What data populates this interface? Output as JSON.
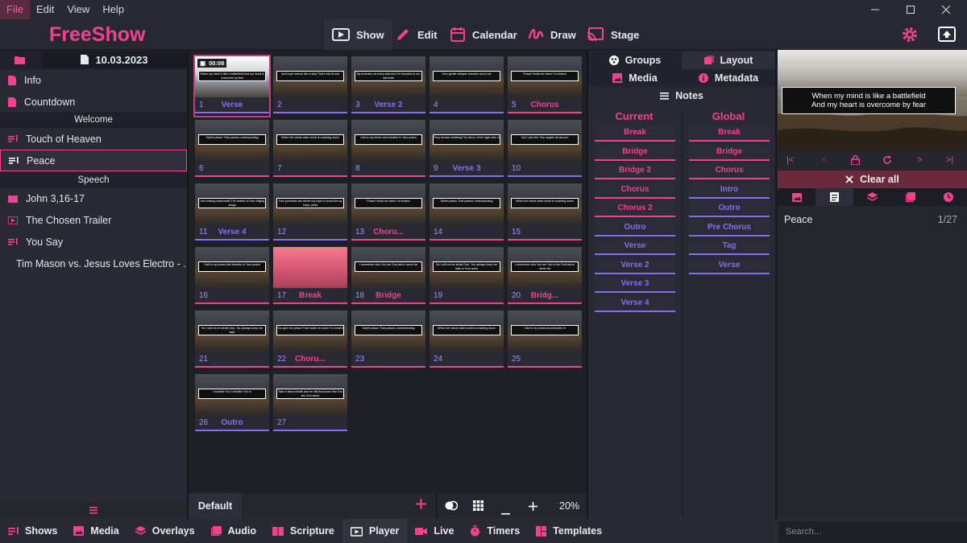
{
  "menubar": {
    "items": [
      "File",
      "Edit",
      "View",
      "Help"
    ]
  },
  "app": {
    "name": "FreeShow"
  },
  "nav": {
    "tabs": [
      {
        "label": "Show",
        "icon": "monitor-play-icon"
      },
      {
        "label": "Edit",
        "icon": "pencil-icon"
      },
      {
        "label": "Calendar",
        "icon": "calendar-icon"
      },
      {
        "label": "Draw",
        "icon": "scribble-icon"
      },
      {
        "label": "Stage",
        "icon": "cast-icon"
      }
    ]
  },
  "left": {
    "date": "10.03.2023",
    "items": [
      {
        "label": "Info",
        "icon": "document-icon"
      },
      {
        "label": "Countdown",
        "icon": "document-icon"
      }
    ],
    "sections": [
      "Welcome",
      "Speech"
    ],
    "welcome_items": [
      "Touch of Heaven",
      "Peace"
    ],
    "speech_items": [
      "John 3,16-17",
      "The Chosen Trailer",
      "You Say",
      "Tim Mason vs. Jesus Loves Electro - ..."
    ]
  },
  "slides": [
    {
      "n": "1",
      "group": "Verse",
      "color": "#8a6cf0",
      "cap": "When my mind is like a battlefield And my heart is overcome by fear",
      "bg": "bright",
      "timer": "00:08"
    },
    {
      "n": "2",
      "group": "",
      "color": "#8a6cf0",
      "cap": "And hope seems like a ship That's lost at sea",
      "bg": "dark"
    },
    {
      "n": "3",
      "group": "Verse 2",
      "color": "#8a6cf0",
      "cap": "My enemies on every side And I'm tempted to run and hide",
      "bg": "dark"
    },
    {
      "n": "4",
      "group": "",
      "color": "#8a6cf0",
      "cap": "Your gentle whisper reaches out to me",
      "bg": "dark"
    },
    {
      "n": "5",
      "group": "Chorus",
      "color": "#f0438f",
      "cap": "Peace Holds me when I'm broken",
      "bg": "dark"
    },
    {
      "n": "6",
      "group": "",
      "color": "#f0438f",
      "cap": "Sweet peace That passes understanding",
      "bg": "dark"
    },
    {
      "n": "7",
      "group": "",
      "color": "#f0438f",
      "cap": "When the whole wide world Is crashing down",
      "bg": "dark"
    },
    {
      "n": "8",
      "group": "",
      "color": "#f0438f",
      "cap": "I fall to my knees And breathe in Your peace",
      "bg": "dark"
    },
    {
      "n": "9",
      "group": "Verse 3",
      "color": "#8a6cf0",
      "cap": "Fiery arrows whistling The terror of the night sets in",
      "bg": "dark"
    },
    {
      "n": "10",
      "group": "",
      "color": "#8a6cf0",
      "cap": "But I can feel Your angels all around",
      "bg": "dark"
    },
    {
      "n": "11",
      "group": "Verse 4",
      "color": "#8a6cf0",
      "cap": "I am resting underneath The shelter of Your Mighty wings",
      "bg": "dark"
    },
    {
      "n": "12",
      "group": "",
      "color": "#8a6cf0",
      "cap": "Your promises are where my hope is found All my hope, yeah",
      "bg": "dark"
    },
    {
      "n": "13",
      "group": "Choru...",
      "color": "#f0438f",
      "cap": "Peace Holds me when I'm broken",
      "bg": "dark"
    },
    {
      "n": "14",
      "group": "",
      "color": "#f0438f",
      "cap": "Sweet peace That passes understanding",
      "bg": "dark"
    },
    {
      "n": "15",
      "group": "",
      "color": "#f0438f",
      "cap": "When the whole wide world Is crashing down",
      "bg": "dark"
    },
    {
      "n": "16",
      "group": "",
      "color": "#f0438f",
      "cap": "I fall to my knees And breathe in Your peace",
      "bg": "dark"
    },
    {
      "n": "17",
      "group": "Break",
      "color": "#f0438f",
      "cap": "",
      "bg": "pink"
    },
    {
      "n": "18",
      "group": "Bridge",
      "color": "#f0438f",
      "cap": "I remember who You are God who's never far",
      "bg": "dark"
    },
    {
      "n": "19",
      "group": "",
      "color": "#f0438f",
      "cap": "So I will not be afraid God, You always keep me safe in Your arms",
      "bg": "dark"
    },
    {
      "n": "20",
      "group": "Bridg...",
      "color": "#f0438f",
      "cap": "I remember who You are You're the God who's never far",
      "bg": "dark"
    },
    {
      "n": "21",
      "group": "",
      "color": "#f0438f",
      "cap": "So I will not be afraid God, You always keep me safe",
      "bg": "dark"
    },
    {
      "n": "22",
      "group": "Choru...",
      "color": "#f0438f",
      "cap": "You give me peace That holds me when I'm broken",
      "bg": "dark"
    },
    {
      "n": "23",
      "group": "",
      "color": "#f0438f",
      "cap": "Sweet peace That passes understanding",
      "bg": "dark"
    },
    {
      "n": "24",
      "group": "",
      "color": "#f0438f",
      "cap": "When the whole wide world Is crashing down",
      "bg": "dark"
    },
    {
      "n": "25",
      "group": "",
      "color": "#f0438f",
      "cap": "I fall to my knees And breathe in",
      "bg": "dark"
    },
    {
      "n": "26",
      "group": "Outro",
      "color": "#8a6cf0",
      "cap": "I breathe You I breathe You in",
      "bg": "dark"
    },
    {
      "n": "27",
      "group": "",
      "color": "#8a6cf0",
      "cap": "Take a deep breath and be still And know that You are God alone",
      "bg": "dark"
    }
  ],
  "center_foot": {
    "layout": "Default",
    "zoom": "20%"
  },
  "right": {
    "tabs": [
      "Groups",
      "Layout",
      "Media",
      "Metadata",
      "Notes"
    ],
    "current_title": "Current",
    "global_title": "Global",
    "current": [
      {
        "label": "Break",
        "color": "#f0438f"
      },
      {
        "label": "Bridge",
        "color": "#f0438f"
      },
      {
        "label": "Bridge 2",
        "color": "#f0438f"
      },
      {
        "label": "Chorus",
        "color": "#f0438f"
      },
      {
        "label": "Chorus 2",
        "color": "#f0438f"
      },
      {
        "label": "Outro",
        "color": "#8a6cf0"
      },
      {
        "label": "Verse",
        "color": "#8a6cf0"
      },
      {
        "label": "Verse 2",
        "color": "#8a6cf0"
      },
      {
        "label": "Verse 3",
        "color": "#8a6cf0"
      },
      {
        "label": "Verse 4",
        "color": "#8a6cf0"
      }
    ],
    "global": [
      {
        "label": "Break",
        "color": "#f0438f"
      },
      {
        "label": "Bridge",
        "color": "#f0438f"
      },
      {
        "label": "Chorus",
        "color": "#f0438f"
      },
      {
        "label": "Intro",
        "color": "#8a6cf0"
      },
      {
        "label": "Outro",
        "color": "#8a6cf0"
      },
      {
        "label": "Pre Chorus",
        "color": "#8a6cf0"
      },
      {
        "label": "Tag",
        "color": "#8a6cf0"
      },
      {
        "label": "Verse",
        "color": "#8a6cf0"
      }
    ]
  },
  "preview": {
    "caption_line1": "When my mind is like a battlefield",
    "caption_line2": "And my heart is overcome by fear",
    "clear_all": "Clear all",
    "show_name": "Peace",
    "count": "1/27"
  },
  "bottom": {
    "tabs": [
      "Shows",
      "Media",
      "Overlays",
      "Audio",
      "Scripture",
      "Player",
      "Live",
      "Timers",
      "Templates"
    ],
    "search_placeholder": "Search..."
  },
  "colors": {
    "accent": "#f0438f",
    "secondary": "#8a6cf0",
    "bg": "#23232d"
  }
}
